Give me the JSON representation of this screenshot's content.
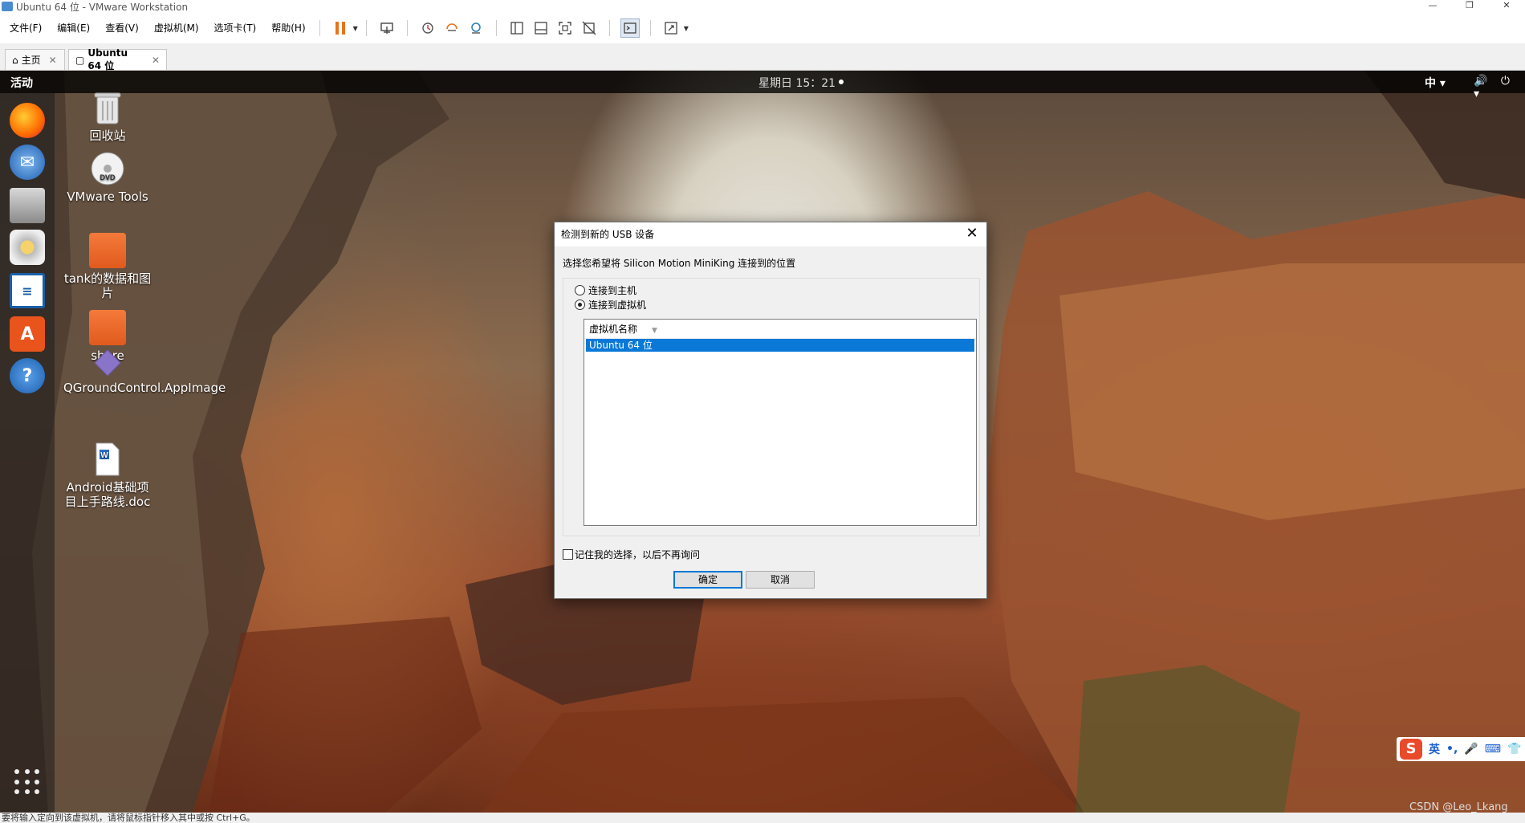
{
  "window": {
    "title": "Ubuntu 64 位 - VMware Workstation",
    "controls": [
      "—",
      "❐",
      "✕"
    ]
  },
  "menubar": {
    "items": [
      "文件(F)",
      "编辑(E)",
      "查看(V)",
      "虚拟机(M)",
      "选项卡(T)",
      "帮助(H)"
    ]
  },
  "toolbar": {
    "icons": [
      "pause-icon",
      "send-keys-icon",
      "snapshot-icon",
      "revert-snapshot-icon",
      "manage-snapshots-icon",
      "library-icon",
      "thumbnail-icon",
      "fullscreen-icon",
      "unity-icon",
      "console-icon",
      "stretch-icon"
    ]
  },
  "tabs": [
    {
      "label": "主页",
      "icon": "home-icon",
      "close": "✕"
    },
    {
      "label": "Ubuntu 64 位",
      "icon": "vm-icon",
      "close": "✕"
    }
  ],
  "guest": {
    "topbar": {
      "activities": "活动",
      "clock": "星期日 15：21",
      "ime": "中 ▾",
      "system": "🔊 ⏻ ▾"
    },
    "desktop_icons": [
      {
        "label": "回收站"
      },
      {
        "label": "VMware Tools"
      },
      {
        "label": "tank的数据和图片"
      },
      {
        "label": "share"
      },
      {
        "label": "QGroundControl.AppImage"
      },
      {
        "label": "Android基础项目上手路线.doc"
      }
    ]
  },
  "dialog": {
    "title": "检测到新的 USB 设备",
    "close": "✕",
    "prompt": "选择您希望将 Silicon Motion MiniKing 连接到的位置",
    "options": [
      {
        "label": "连接到主机",
        "checked": false
      },
      {
        "label": "连接到虚拟机",
        "checked": true
      }
    ],
    "list_header": "虚拟机名称",
    "list_rows": [
      "Ubuntu 64 位"
    ],
    "remember_label": "记住我的选择，以后不再询问",
    "remember_checked": false,
    "ok_label": "确定",
    "cancel_label": "取消"
  },
  "ime_bar": {
    "logo": "S",
    "mode": "英",
    "items": [
      "•,",
      "🎤",
      "⌨",
      "👕"
    ]
  },
  "watermark": "CSDN @Leo_Lkang",
  "statusbar": "要将输入定向到该虚拟机，请将鼠标指针移入其中或按 Ctrl+G。",
  "colors": {
    "accent": "#0a78d7",
    "pause": "#e8731a",
    "folder": "#e9652a",
    "topbar": "#1a1a1a"
  }
}
